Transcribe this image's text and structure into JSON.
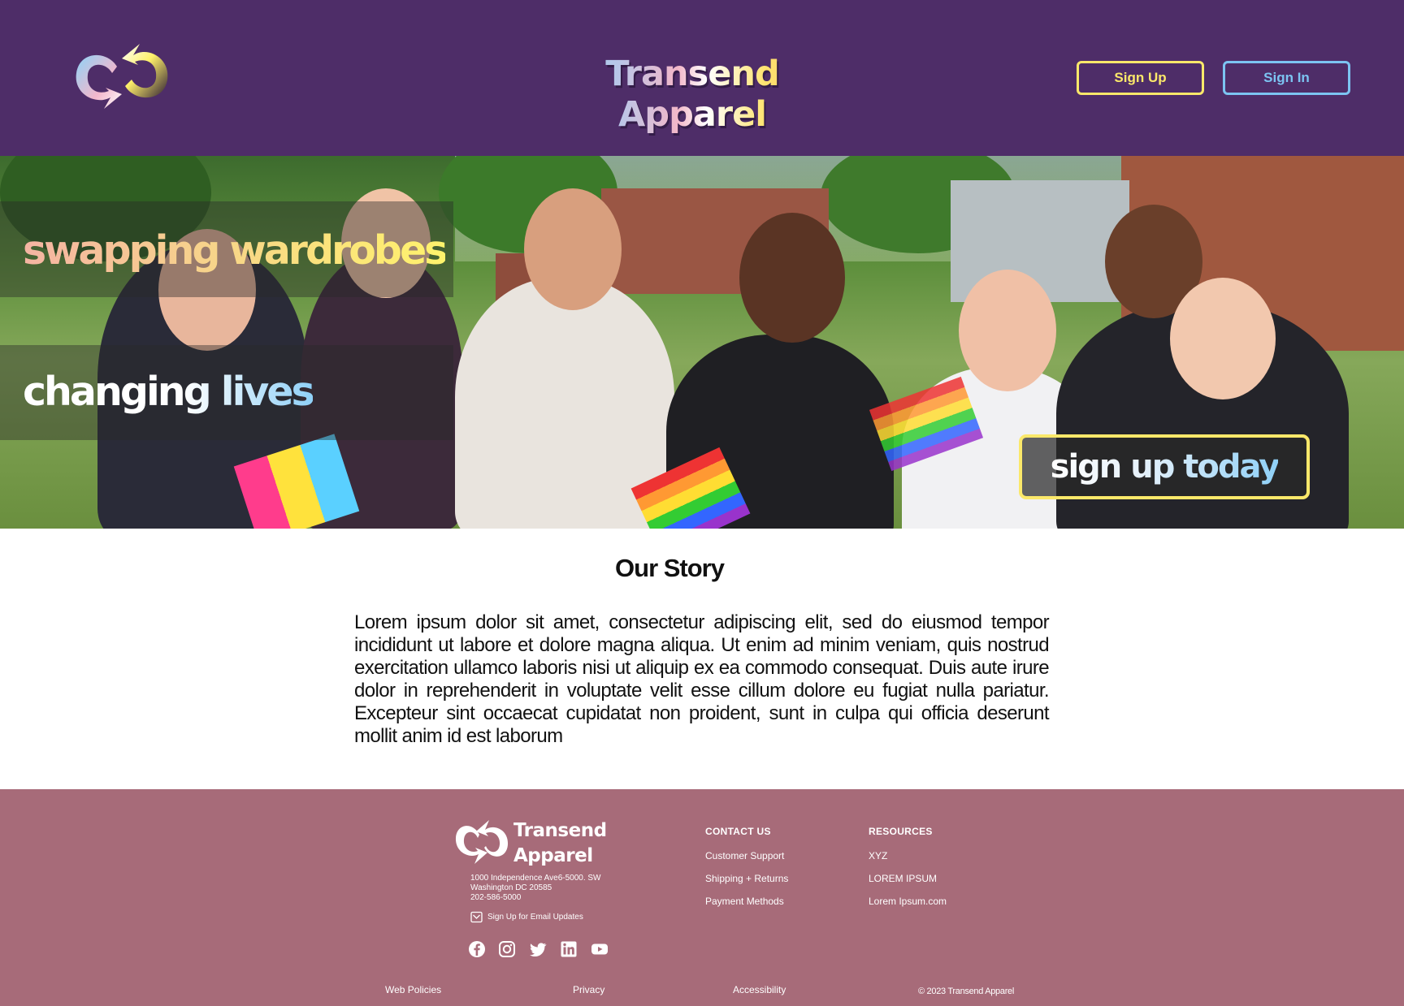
{
  "header": {
    "brand": "Transend Apparel",
    "signup_label": "Sign Up",
    "signin_label": "Sign In"
  },
  "hero": {
    "line1": "swapping wardrobes",
    "line2": "changing lives",
    "cta_label": "sign up today"
  },
  "story": {
    "title": "Our Story",
    "body": "Lorem ipsum dolor sit amet, consectetur adipiscing elit, sed do eiusmod tempor incididunt ut labore et dolore magna aliqua. Ut enim ad minim veniam, quis nostrud exercitation ullamco laboris nisi ut aliquip ex ea commodo consequat. Duis aute irure dolor in reprehenderit in voluptate velit esse cillum dolore eu fugiat nulla pariatur. Excepteur sint occaecat cupidatat non proident, sunt in culpa qui officia deserunt mollit anim id est laborum"
  },
  "footer": {
    "brand_line1": "Transend",
    "brand_line2": "Apparel",
    "address_line1": "1000 Independence Ave6-5000. SW",
    "address_line2": "Washington DC 20585",
    "phone": "202-586-5000",
    "email_updates": "Sign Up for Email Updates",
    "social_icons": [
      "facebook-icon",
      "instagram-icon",
      "twitter-icon",
      "linkedin-icon",
      "youtube-icon"
    ],
    "contact": {
      "heading": "CONTACT US",
      "items": [
        "Customer Support",
        "Shipping + Returns",
        "Payment Methods"
      ]
    },
    "resources": {
      "heading": "RESOURCES",
      "items": [
        "XYZ",
        "LOREM IPSUM",
        "Lorem Ipsum.com"
      ]
    },
    "bottom_links": [
      "Web Policies",
      "Privacy",
      "Accessibility"
    ],
    "copyright": "© 2023 Transend Apparel"
  },
  "colors": {
    "header_bg": "#4e2d68",
    "footer_bg": "#a76b79",
    "accent_yellow": "#fbe86a",
    "accent_blue": "#7cc4f2"
  }
}
